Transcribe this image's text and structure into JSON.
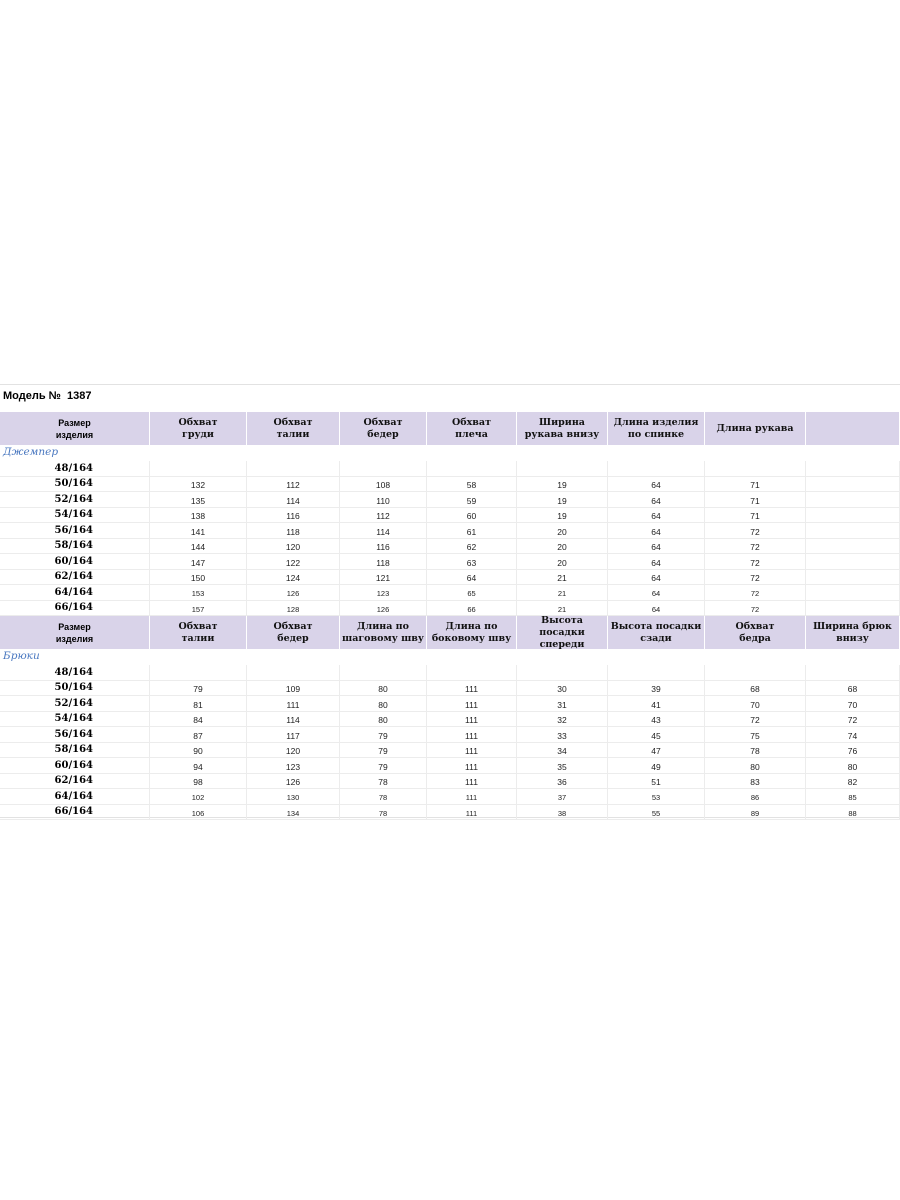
{
  "title": "Модель №  1387",
  "jumper": {
    "section_label": "Джемпер",
    "headers": [
      "Размер\nизделия",
      "Обхват\nгруди",
      "Обхват\nталии",
      "Обхват\nбедер",
      "Обхват\nплеча",
      "Ширина\nрукава внизу",
      "Длина изделия\nпо спинке",
      "Длина рукава",
      ""
    ],
    "rows": [
      [
        "48/164",
        "",
        "",
        "",
        "",
        "",
        "",
        "",
        ""
      ],
      [
        "50/164",
        "132",
        "112",
        "108",
        "58",
        "19",
        "64",
        "71",
        ""
      ],
      [
        "52/164",
        "135",
        "114",
        "110",
        "59",
        "19",
        "64",
        "71",
        ""
      ],
      [
        "54/164",
        "138",
        "116",
        "112",
        "60",
        "19",
        "64",
        "71",
        ""
      ],
      [
        "56/164",
        "141",
        "118",
        "114",
        "61",
        "20",
        "64",
        "72",
        ""
      ],
      [
        "58/164",
        "144",
        "120",
        "116",
        "62",
        "20",
        "64",
        "72",
        ""
      ],
      [
        "60/164",
        "147",
        "122",
        "118",
        "63",
        "20",
        "64",
        "72",
        ""
      ],
      [
        "62/164",
        "150",
        "124",
        "121",
        "64",
        "21",
        "64",
        "72",
        ""
      ],
      [
        "64/164",
        "153",
        "126",
        "123",
        "65",
        "21",
        "64",
        "72",
        ""
      ],
      [
        "66/164",
        "157",
        "128",
        "126",
        "66",
        "21",
        "64",
        "72",
        ""
      ]
    ]
  },
  "trousers": {
    "section_label": "Брюки",
    "headers": [
      "Размер\nизделия",
      "Обхват\nталии",
      "Обхват\nбедер",
      "Длина по\nшаговому шву",
      "Длина по\nбоковому шву",
      "Высота посадки\nспереди",
      "Высота посадки\nсзади",
      "Обхват\nбедра",
      "Ширина брюк\nвнизу"
    ],
    "rows": [
      [
        "48/164",
        "",
        "",
        "",
        "",
        "",
        "",
        "",
        ""
      ],
      [
        "50/164",
        "79",
        "109",
        "80",
        "111",
        "30",
        "39",
        "68",
        "68"
      ],
      [
        "52/164",
        "81",
        "111",
        "80",
        "111",
        "31",
        "41",
        "70",
        "70"
      ],
      [
        "54/164",
        "84",
        "114",
        "80",
        "111",
        "32",
        "43",
        "72",
        "72"
      ],
      [
        "56/164",
        "87",
        "117",
        "79",
        "111",
        "33",
        "45",
        "75",
        "74"
      ],
      [
        "58/164",
        "90",
        "120",
        "79",
        "111",
        "34",
        "47",
        "78",
        "76"
      ],
      [
        "60/164",
        "94",
        "123",
        "79",
        "111",
        "35",
        "49",
        "80",
        "80"
      ],
      [
        "62/164",
        "98",
        "126",
        "78",
        "111",
        "36",
        "51",
        "83",
        "82"
      ],
      [
        "64/164",
        "102",
        "130",
        "78",
        "111",
        "37",
        "53",
        "86",
        "85"
      ],
      [
        "66/164",
        "106",
        "134",
        "78",
        "111",
        "38",
        "55",
        "89",
        "88"
      ]
    ]
  }
}
